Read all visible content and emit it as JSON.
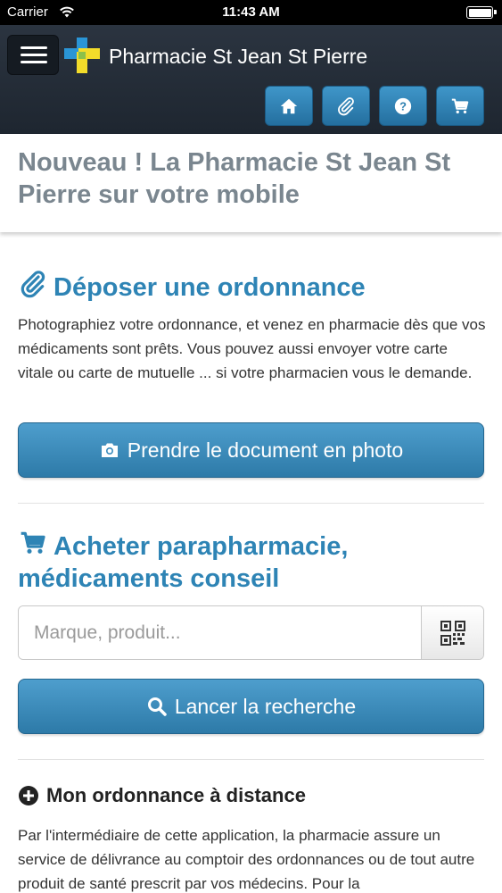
{
  "status_bar": {
    "carrier": "Carrier",
    "time": "11:43 AM"
  },
  "header": {
    "title": "Pharmacie St Jean St Pierre",
    "nav": [
      {
        "icon": "home-icon"
      },
      {
        "icon": "paperclip-icon"
      },
      {
        "icon": "help-icon"
      },
      {
        "icon": "cart-icon"
      }
    ],
    "colors": {
      "logo_blue": "#2a95d6",
      "logo_yellow": "#f3dc2a",
      "accent": "#2e84b5"
    }
  },
  "hero": {
    "title": "Nouveau ! La Pharmacie St Jean St Pierre sur votre mobile"
  },
  "prescription": {
    "title": "Déposer une ordonnance",
    "description": "Photographiez votre ordonnance, et venez en pharmacie dès que vos médicaments sont prêts. Vous pouvez aussi envoyer votre carte vitale ou carte de mutuelle ... si votre pharmacien vous le demande.",
    "photo_button": "Prendre le document en photo"
  },
  "shop": {
    "title": "Acheter parapharmacie, médicaments conseil",
    "search_placeholder": "Marque, produit...",
    "search_button": "Lancer la recherche"
  },
  "remote": {
    "title": "Mon ordonnance à distance",
    "description": "Par l'intermédiaire de cette application, la pharmacie assure un service de délivrance au comptoir des ordonnances ou de tout autre produit de santé prescrit par vos médecins. Pour la"
  }
}
